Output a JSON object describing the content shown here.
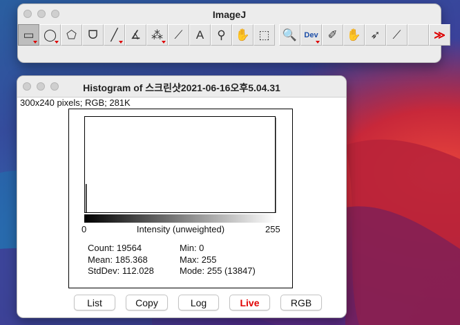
{
  "theme": {
    "live_color": "#e00000",
    "toolbar_more_color": "#d00000"
  },
  "imagej": {
    "title": "ImageJ",
    "tools": [
      {
        "name": "rectangle-tool",
        "icon": "rectangle-selection-icon",
        "glyph": "▭",
        "selected": true,
        "has_menu": true
      },
      {
        "name": "oval-tool",
        "icon": "oval-selection-icon",
        "glyph": "◯",
        "has_menu": true
      },
      {
        "name": "polygon-tool",
        "icon": "polygon-selection-icon",
        "glyph": "⬠"
      },
      {
        "name": "freehand-tool",
        "icon": "freehand-selection-icon",
        "glyph": "ᗜ"
      },
      {
        "name": "line-tool",
        "icon": "straight-line-icon",
        "glyph": "╱",
        "has_menu": true
      },
      {
        "name": "angle-tool",
        "icon": "angle-icon",
        "glyph": "∡"
      },
      {
        "name": "point-tool",
        "icon": "multipoint-icon",
        "glyph": "⁂",
        "has_menu": true
      },
      {
        "name": "wand-tool",
        "icon": "wand-icon",
        "glyph": "⟋"
      },
      {
        "name": "text-tool",
        "icon": "text-icon",
        "glyph": "A"
      },
      {
        "name": "magnifier-tool",
        "icon": "magnifier-icon",
        "glyph": "⚲"
      },
      {
        "name": "hand-tool",
        "icon": "scroll-hand-icon",
        "glyph": "✋"
      },
      {
        "name": "color-picker-tool",
        "icon": "color-picker-icon",
        "glyph": "⬚"
      },
      {
        "gap": true
      },
      {
        "name": "zoom-tool",
        "icon": "zoom-icon",
        "glyph": "🔍"
      },
      {
        "name": "developer-menu-tool",
        "icon": "developer-menu-icon",
        "text": "Dev",
        "has_menu": true
      },
      {
        "name": "brush-tool",
        "icon": "brush-icon",
        "glyph": "✐"
      },
      {
        "name": "flood-fill-tool",
        "icon": "flood-fill-icon",
        "glyph": "✋"
      },
      {
        "name": "arrow-tool",
        "icon": "arrow-icon",
        "glyph": "➶"
      },
      {
        "name": "angle-tool-2",
        "icon": "angle-draw-icon",
        "glyph": "⟋"
      },
      {
        "name": "blank-tool",
        "icon": "empty-slot-icon",
        "glyph": ""
      },
      {
        "name": "more-tools",
        "icon": "more-tools-chevron-icon",
        "glyph": "≫",
        "more": true
      }
    ]
  },
  "histogram": {
    "title": "Histogram of 스크린샷2021-06-16오후5.04.31",
    "info": "300x240 pixels; RGB; 281K",
    "axis": {
      "min": "0",
      "max": "255",
      "label": "Intensity (unweighted)"
    },
    "stats": {
      "col1": [
        "Count: 19564",
        "Mean: 185.368",
        "StdDev: 112.028"
      ],
      "col2": [
        "Min: 0",
        "Max: 255",
        "Mode: 255 (13847)"
      ]
    },
    "buttons": [
      {
        "name": "list-button",
        "label": "List",
        "width": 60
      },
      {
        "name": "copy-button",
        "label": "Copy",
        "width": 61
      },
      {
        "name": "log-button",
        "label": "Log",
        "width": 59
      },
      {
        "name": "live-button",
        "label": "Live",
        "width": 59,
        "live": true
      },
      {
        "name": "rgb-button",
        "label": "RGB",
        "width": 60
      }
    ]
  },
  "chart_data": {
    "type": "bar",
    "title": "",
    "xlabel": "Intensity (unweighted)",
    "ylabel": "",
    "xlim": [
      0,
      255
    ],
    "ylim": [
      0,
      13847
    ],
    "x": [
      0,
      255
    ],
    "values": [
      4200,
      13847
    ]
  }
}
